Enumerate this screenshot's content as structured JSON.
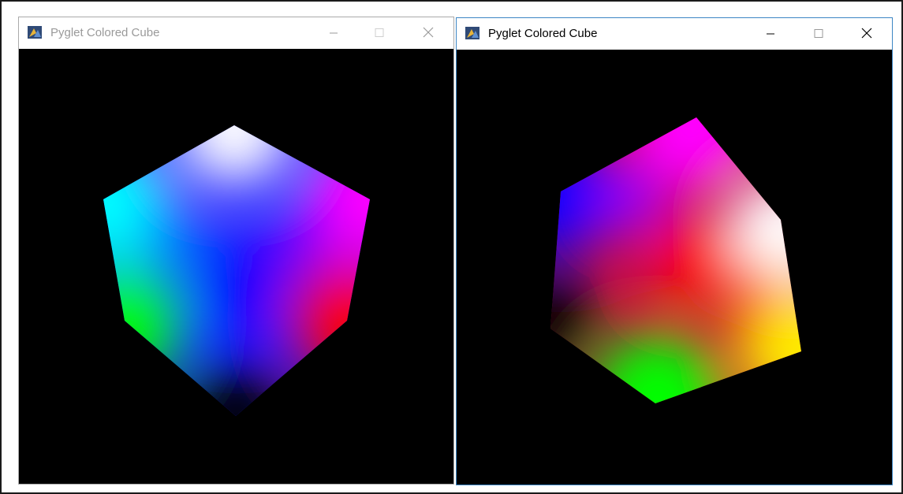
{
  "windows": [
    {
      "title": "Pyglet Colored Cube",
      "state": "inactive",
      "controls": [
        "minimize",
        "maximize",
        "close"
      ],
      "view": "cube viewed corner-on with white vertex at top",
      "vertex_colors": [
        "#ffffff",
        "#00ffff",
        "#ff00ff",
        "#0000ff",
        "#00ff00",
        "#ff0000",
        "#000000"
      ]
    },
    {
      "title": "Pyglet Colored Cube",
      "state": "active",
      "controls": [
        "minimize",
        "maximize",
        "close"
      ],
      "view": "rotated cube with red vertex at center",
      "vertex_colors": [
        "#ff00ff",
        "#0000ff",
        "#ffffff",
        "#ffff00",
        "#00ff00",
        "#000000",
        "#ff0000"
      ]
    }
  ],
  "colors": {
    "active_border": "#3c86c4",
    "inactive_border": "#aaaaaa",
    "inactive_title": "#9a9a9a",
    "canvas_background": "#000000"
  },
  "icons": {
    "app": "pyglet-app-icon",
    "minimize": "minimize-icon",
    "maximize": "maximize-icon",
    "close": "close-icon"
  }
}
